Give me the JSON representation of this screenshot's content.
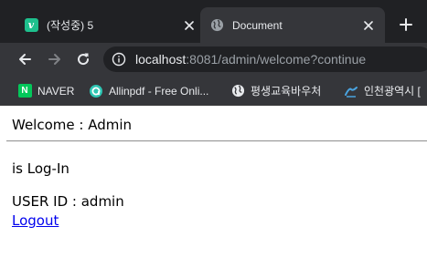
{
  "tabs": [
    {
      "label": "(작성중) 5",
      "favicon": "v-icon",
      "close_icon": "close-icon"
    },
    {
      "label": "Document",
      "favicon": "globe-icon",
      "close_icon": "close-icon"
    }
  ],
  "new_tab_icon": "plus-icon",
  "toolbar": {
    "back_icon": "back-arrow-icon",
    "forward_icon": "forward-arrow-icon",
    "reload_icon": "reload-icon",
    "site_info_icon": "info-icon",
    "url_host": "localhost",
    "url_rest": ":8081/admin/welcome?continue"
  },
  "bookmarks": [
    {
      "label": "NAVER",
      "icon": "naver-icon",
      "icon_text": "N"
    },
    {
      "label": "Allinpdf - Free Onli...",
      "icon": "allinpdf-icon"
    },
    {
      "label": "평생교육바우처",
      "icon": "globe-icon"
    },
    {
      "label": "인천광역시 [",
      "icon": "incheon-icon"
    }
  ],
  "page": {
    "welcome_text": "Welcome : Admin",
    "status_text": "is Log-In",
    "user_id_text": "USER ID : admin",
    "logout_label": "Logout"
  },
  "colors": {
    "tabstrip_bg": "#202124",
    "toolbar_bg": "#35363a",
    "link": "#0000ee",
    "naver_green": "#03c75a",
    "velog_green": "#1ec08d"
  }
}
